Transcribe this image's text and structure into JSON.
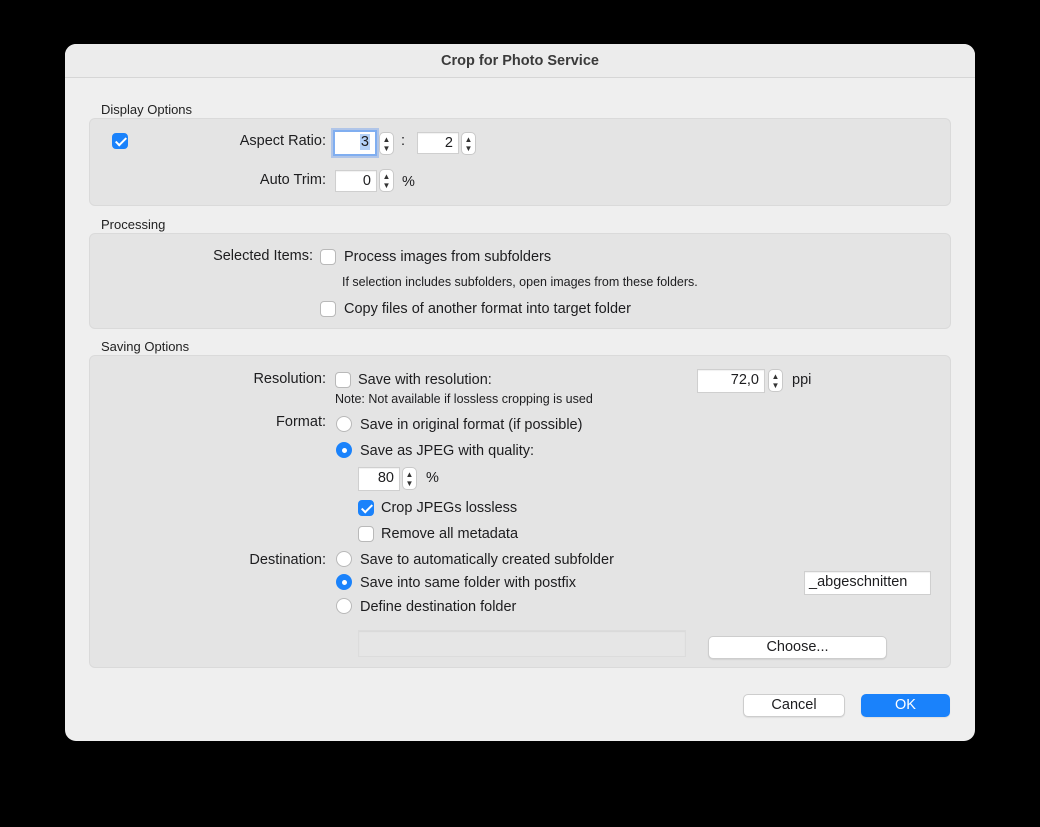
{
  "dialog": {
    "title": "Crop for Photo Service"
  },
  "display_options": {
    "section_label": "Display Options",
    "enabled": true,
    "aspect_ratio_label": "Aspect Ratio:",
    "aspect_ratio_w": "3",
    "ratio_separator": ":",
    "aspect_ratio_h": "2",
    "auto_trim_label": "Auto Trim:",
    "auto_trim_value": "0",
    "auto_trim_unit": "%"
  },
  "processing": {
    "section_label": "Processing",
    "selected_items_label": "Selected Items:",
    "process_subfolders_label": "Process images from subfolders",
    "process_subfolders_checked": false,
    "subfolders_hint": "If selection includes subfolders, open images from these folders.",
    "copy_files_label": "Copy files of another format into target folder",
    "copy_files_checked": false
  },
  "saving_options": {
    "section_label": "Saving Options",
    "resolution_label": "Resolution:",
    "save_with_resolution_label": "Save with resolution:",
    "save_with_resolution_checked": false,
    "resolution_value": "72,0",
    "resolution_unit": "ppi",
    "resolution_note": "Note: Not available if lossless cropping is used",
    "format_label": "Format:",
    "format_original_label": "Save in original format (if possible)",
    "format_jpeg_label": "Save as JPEG with quality:",
    "format_selected": "jpeg",
    "jpeg_quality_value": "80",
    "jpeg_quality_unit": "%",
    "crop_lossless_label": "Crop JPEGs lossless",
    "crop_lossless_checked": true,
    "remove_metadata_label": "Remove all metadata",
    "remove_metadata_checked": false,
    "destination_label": "Destination:",
    "dest_auto_subfolder_label": "Save to automatically created subfolder",
    "dest_same_folder_label": "Save into same folder with postfix",
    "dest_define_label": "Define destination folder",
    "destination_selected": "same_folder",
    "postfix_value": "_abgeschnitten",
    "destination_path_value": "",
    "choose_button": "Choose..."
  },
  "footer": {
    "cancel_button": "Cancel",
    "ok_button": "OK"
  },
  "colors": {
    "accent": "#1a82fb",
    "window_bg": "#efefef",
    "group_bg": "#e4e4e4"
  },
  "icons": {
    "stepper": "up-down-arrows-icon",
    "checkbox": "checkmark-icon"
  }
}
